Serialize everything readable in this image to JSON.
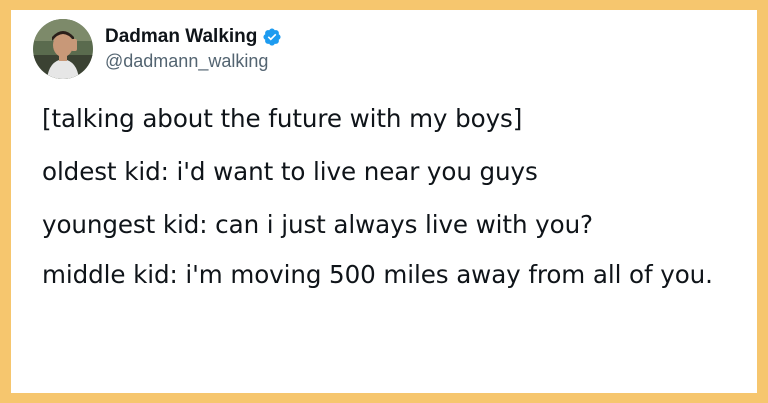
{
  "author": {
    "display_name": "Dadman Walking",
    "handle": "@dadmann_walking",
    "verified": true
  },
  "tweet": {
    "lines": [
      "[talking about the future with my boys]",
      "oldest kid: i'd want to live near you guys",
      "youngest kid: can i just always live with you?",
      "middle kid: i'm moving 500 miles away from all of you."
    ]
  },
  "colors": {
    "border": "#f6c66e",
    "card": "#ffffff",
    "text": "#0f1419",
    "handle": "#536471",
    "verified_badge": "#1d9bf0"
  },
  "icons": {
    "avatar": "profile-photo",
    "badge": "verified-badge-icon"
  }
}
